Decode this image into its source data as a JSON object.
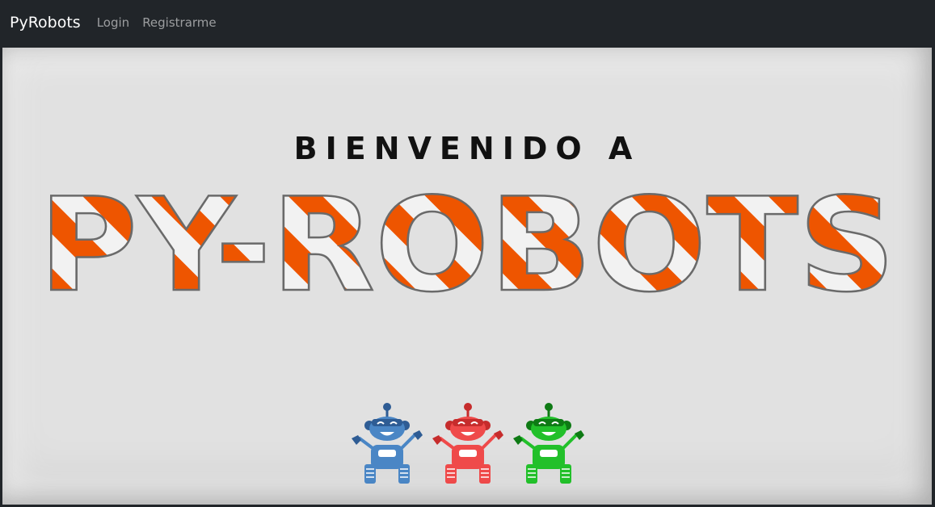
{
  "navbar": {
    "brand": "PyRobots",
    "links": [
      "Login",
      "Registrarme"
    ]
  },
  "hero": {
    "welcome": "BIENVENIDO A",
    "title": "PY-ROBOTS"
  },
  "colors": {
    "navbar_bg": "#212529",
    "stripe_orange": "#ee5500",
    "stripe_white": "#f2f2f2",
    "robot_blue": "#4a86c5",
    "robot_red": "#ef4a4a",
    "robot_green": "#22c02a"
  },
  "robots": [
    {
      "name": "blue-robot",
      "color": "#4a86c5",
      "dark": "#2e5c94"
    },
    {
      "name": "red-robot",
      "color": "#ef4a4a",
      "dark": "#c62c2c"
    },
    {
      "name": "green-robot",
      "color": "#22c02a",
      "dark": "#0e7a14"
    }
  ]
}
